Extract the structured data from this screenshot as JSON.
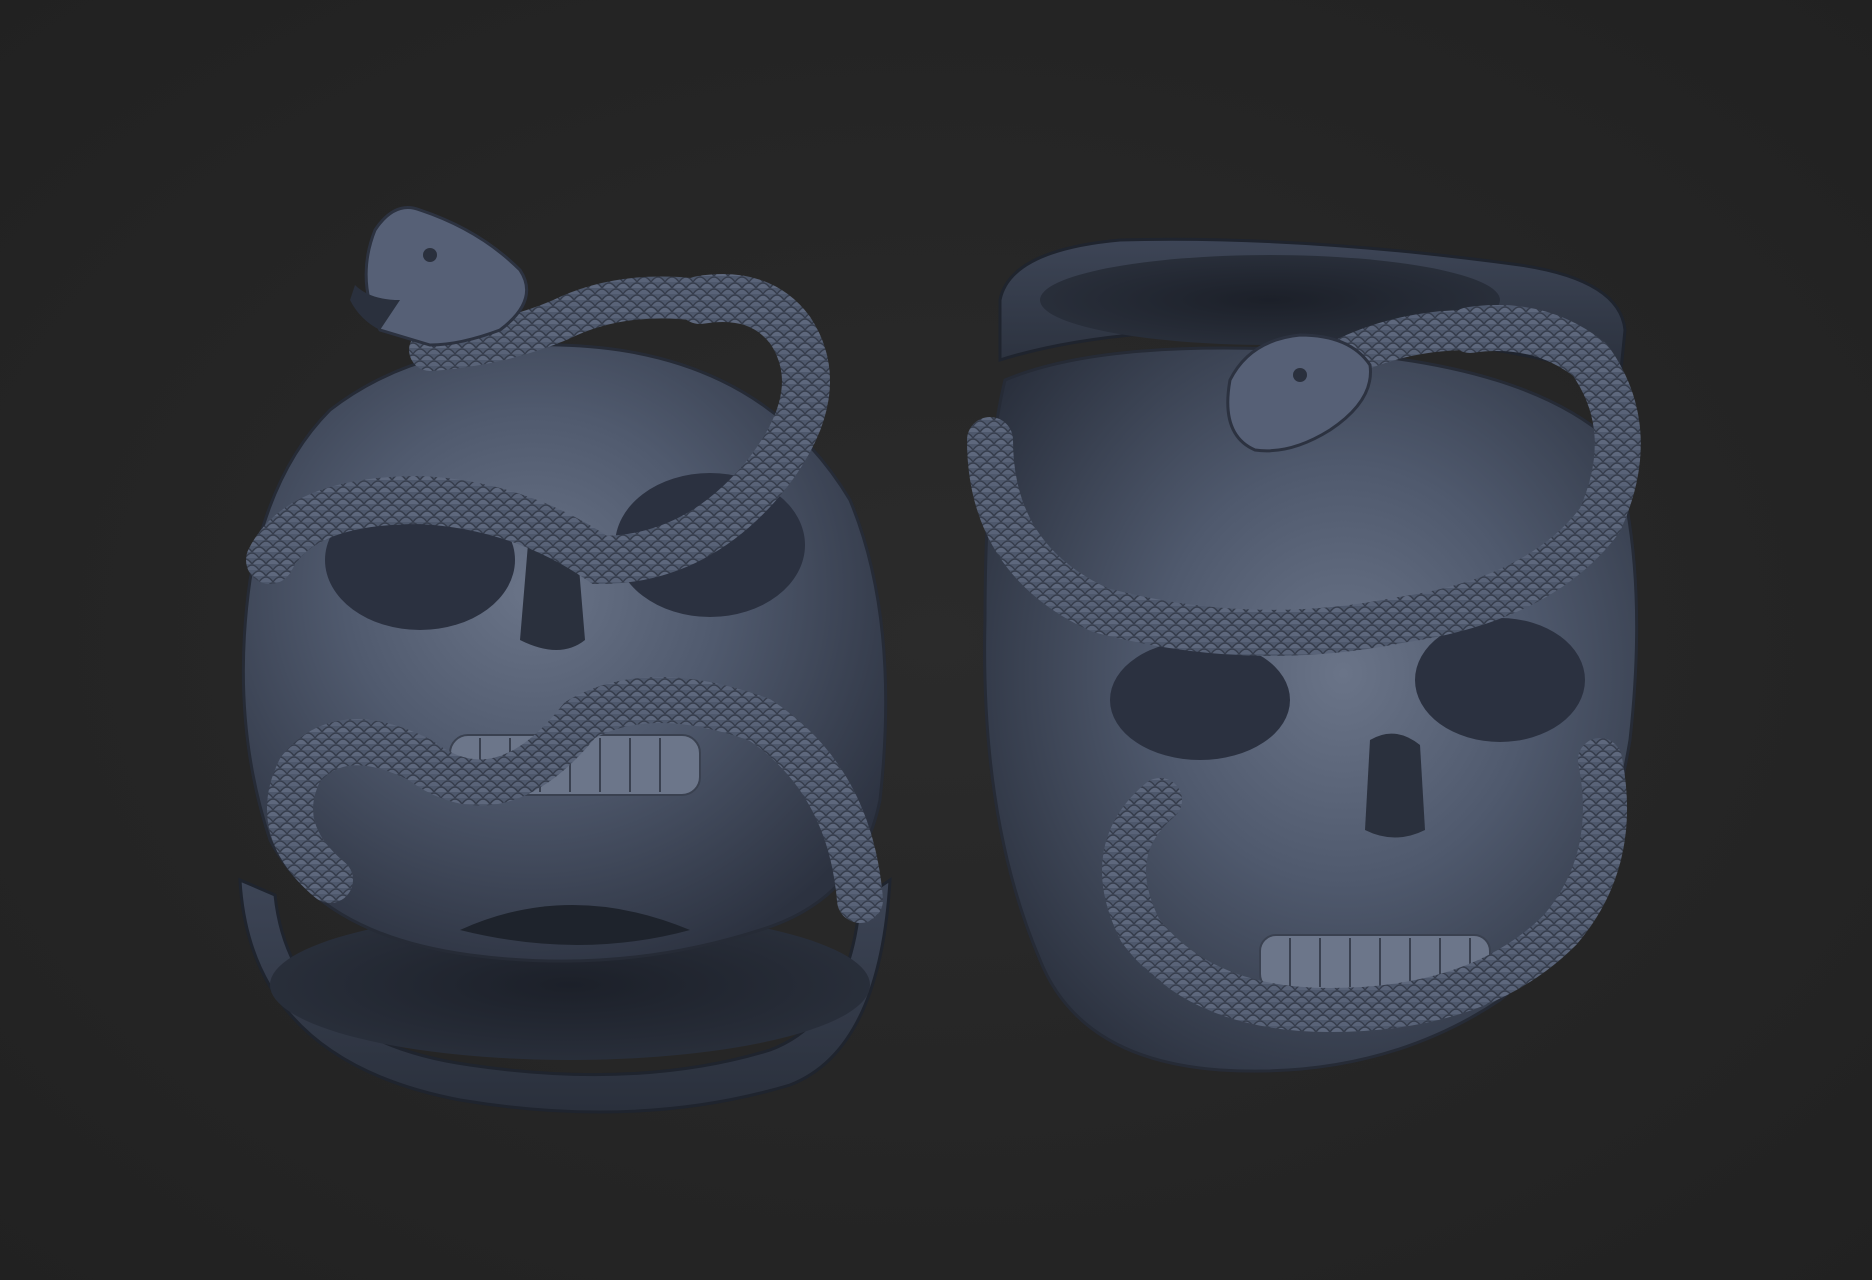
{
  "scene": {
    "background_color": "#262626",
    "material_color": "#4a5468",
    "objects": [
      {
        "name": "skull-snake-ring-front-view"
      },
      {
        "name": "skull-snake-ring-angled-view"
      }
    ]
  }
}
